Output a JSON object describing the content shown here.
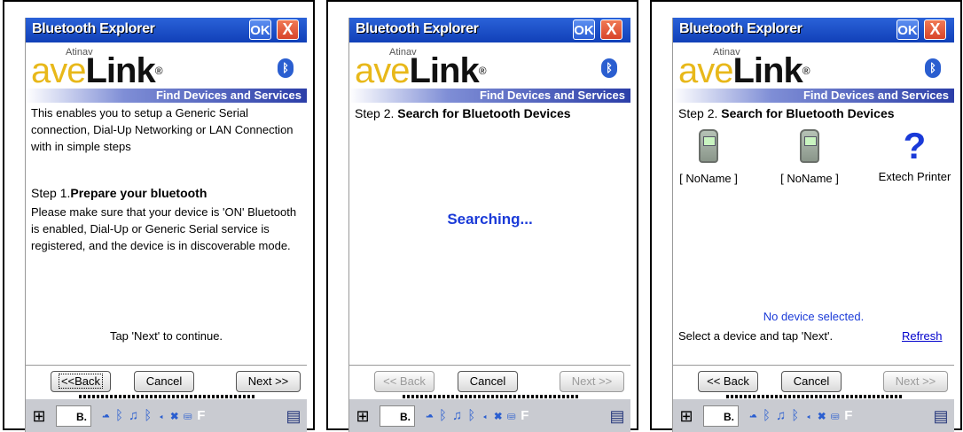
{
  "common": {
    "window_title": "Bluetooth Explorer",
    "ok_label": "OK",
    "close_label": "X",
    "brand_small": "Atinav",
    "brand_ave": "ave",
    "brand_link": "Link",
    "brand_reg": "®",
    "banner_subtitle": "Find Devices and Services",
    "taskbar": {
      "b_label": "B.",
      "f_label": "F"
    }
  },
  "screens": [
    {
      "intro": "This enables you to setup a Generic Serial connection, Dial-Up Networking or LAN Connection with in simple steps",
      "step_prefix": "Step 1.",
      "step_title": "Prepare your bluetooth",
      "instructions": "Please make sure that your device is 'ON' Bluetooth is enabled, Dial-Up or Generic Serial service is registered, and the device is in discoverable mode.",
      "hint": "Tap 'Next' to continue.",
      "back_label": "<<Back",
      "cancel_label": "Cancel",
      "next_label": "Next >>"
    },
    {
      "step_prefix": "Step 2.",
      "step_title": "Search for Bluetooth Devices",
      "status": "Searching...",
      "back_label": "<< Back",
      "cancel_label": "Cancel",
      "next_label": "Next >>"
    },
    {
      "step_prefix": "Step 2.",
      "step_title": "Search for Bluetooth Devices",
      "devices": [
        {
          "name": "[ NoName ]",
          "icon": "phone-icon"
        },
        {
          "name": "[ NoName ]",
          "icon": "phone-icon"
        },
        {
          "name": "Extech Printer",
          "icon": "question-icon"
        }
      ],
      "selection_status": "No device selected.",
      "select_hint": "Select a device and tap 'Next'.",
      "refresh_label": "Refresh",
      "back_label": "<< Back",
      "cancel_label": "Cancel",
      "next_label": "Next >>"
    }
  ]
}
